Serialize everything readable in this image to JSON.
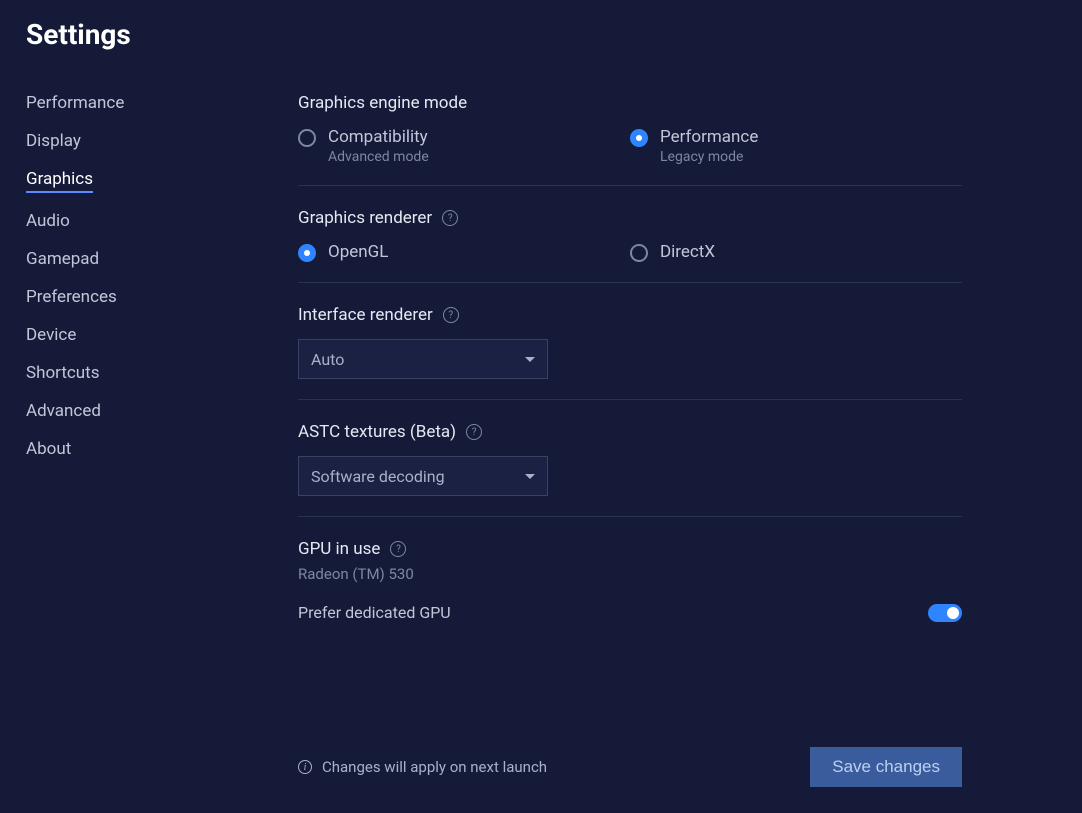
{
  "title": "Settings",
  "sidebar": {
    "items": [
      {
        "label": "Performance"
      },
      {
        "label": "Display"
      },
      {
        "label": "Graphics"
      },
      {
        "label": "Audio"
      },
      {
        "label": "Gamepad"
      },
      {
        "label": "Preferences"
      },
      {
        "label": "Device"
      },
      {
        "label": "Shortcuts"
      },
      {
        "label": "Advanced"
      },
      {
        "label": "About"
      }
    ],
    "active_index": 2
  },
  "engine_mode": {
    "title": "Graphics engine mode",
    "options": [
      {
        "label": "Compatibility",
        "sublabel": "Advanced mode"
      },
      {
        "label": "Performance",
        "sublabel": "Legacy mode"
      }
    ],
    "selected_index": 1
  },
  "renderer": {
    "title": "Graphics renderer",
    "options": [
      {
        "label": "OpenGL"
      },
      {
        "label": "DirectX"
      }
    ],
    "selected_index": 0
  },
  "interface_renderer": {
    "title": "Interface renderer",
    "value": "Auto"
  },
  "astc": {
    "title": "ASTC textures (Beta)",
    "value": "Software decoding"
  },
  "gpu": {
    "title": "GPU in use",
    "value": "Radeon (TM) 530",
    "prefer_label": "Prefer dedicated GPU",
    "prefer_on": true
  },
  "footer": {
    "note": "Changes will apply on next launch",
    "save_label": "Save changes"
  }
}
